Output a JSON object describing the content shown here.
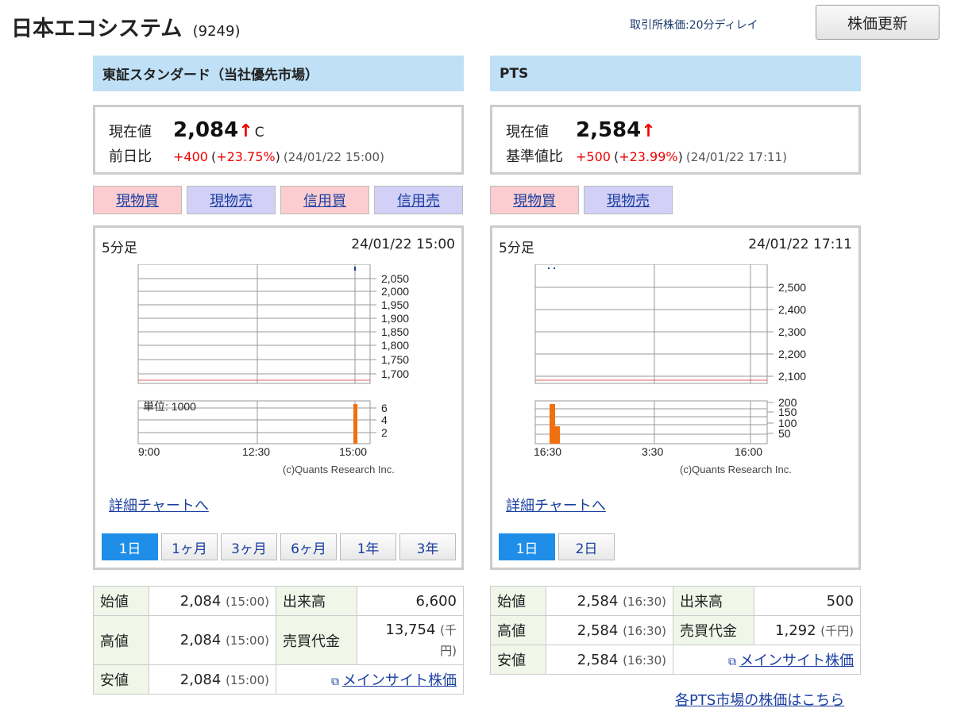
{
  "header": {
    "company": "日本エコシステム",
    "code": "(9249)",
    "delay_note": "取引所株価:20分ディレイ",
    "refresh_label": "株価更新"
  },
  "left": {
    "market": "東証スタンダード（当社優先市場）",
    "price_label": "現在値",
    "price": "2,084",
    "arrow": "↑",
    "close_mark": "C",
    "change_label": "前日比",
    "change": "+400",
    "change_pct": "+23.75%",
    "stamp": "(24/01/22 15:00)",
    "trade_buttons": [
      "現物買",
      "現物売",
      "信用買",
      "信用売"
    ],
    "chart_interval": "5分足",
    "chart_time": "24/01/22 15:00",
    "detail_link": "詳細チャートへ",
    "period_tabs": [
      "1日",
      "1ヶ月",
      "3ヶ月",
      "6ヶ月",
      "1年",
      "3年"
    ],
    "stats": {
      "open_label": "始値",
      "open": "2,084",
      "open_time": "(15:00)",
      "high_label": "高値",
      "high": "2,084",
      "high_time": "(15:00)",
      "low_label": "安値",
      "low": "2,084",
      "low_time": "(15:00)",
      "volume_label": "出来高",
      "volume": "6,600",
      "turnover_label": "売買代金",
      "turnover": "13,754",
      "turnover_unit_a": "(千",
      "turnover_unit_b": "円)",
      "main_link": "メインサイト株価"
    }
  },
  "right": {
    "market": "PTS",
    "price_label": "現在値",
    "price": "2,584",
    "arrow": "↑",
    "change_label": "基準値比",
    "change": "+500",
    "change_pct": "+23.99%",
    "stamp": "(24/01/22 17:11)",
    "trade_buttons": [
      "現物買",
      "現物売"
    ],
    "chart_interval": "5分足",
    "chart_time": "24/01/22 17:11",
    "detail_link": "詳細チャートへ",
    "period_tabs": [
      "1日",
      "2日"
    ],
    "stats": {
      "open_label": "始値",
      "open": "2,584",
      "open_time": "(16:30)",
      "high_label": "高値",
      "high": "2,584",
      "high_time": "(16:30)",
      "low_label": "安値",
      "low": "2,584",
      "low_time": "(16:30)",
      "volume_label": "出来高",
      "volume": "500",
      "turnover_label": "売買代金",
      "turnover": "1,292",
      "turnover_unit": "(千円)",
      "main_link": "メインサイト株価"
    },
    "pts_all_link": "各PTS市場の株価はこちら"
  },
  "chart_data": [
    {
      "type": "line",
      "title": "",
      "price_ticks": [
        "2,050",
        "2,000",
        "1,950",
        "1,900",
        "1,850",
        "1,800",
        "1,750",
        "1,700"
      ],
      "volume_ticks": [
        "6",
        "4",
        "2"
      ],
      "volume_unit_label": "単位: 1000",
      "x_ticks": [
        "9:00",
        "12:30",
        "15:00"
      ],
      "x": [
        "15:00"
      ],
      "price": [
        2084
      ],
      "volume": [
        6.6
      ],
      "reference_line": 1684,
      "credit": "(c)Quants Research Inc."
    },
    {
      "type": "line",
      "title": "",
      "price_ticks": [
        "2,500",
        "2,400",
        "2,300",
        "2,200",
        "2,100"
      ],
      "volume_ticks": [
        "200",
        "150",
        "100",
        "50"
      ],
      "x_ticks": [
        "16:30",
        "3:30",
        "16:00"
      ],
      "x": [
        "16:30",
        "16:35"
      ],
      "price": [
        2584,
        2584
      ],
      "volume": [
        200,
        80
      ],
      "reference_line": 2084,
      "credit": "(c)Quants Research Inc."
    }
  ],
  "colors": {
    "market_head": "#bfe0f6",
    "up": "#e00000",
    "buy": "#fbcdd0",
    "sell": "#d2d0f6",
    "active_tab": "#1f8ee8",
    "volume_bar": "#f07010",
    "ref_line": "#e06060"
  }
}
